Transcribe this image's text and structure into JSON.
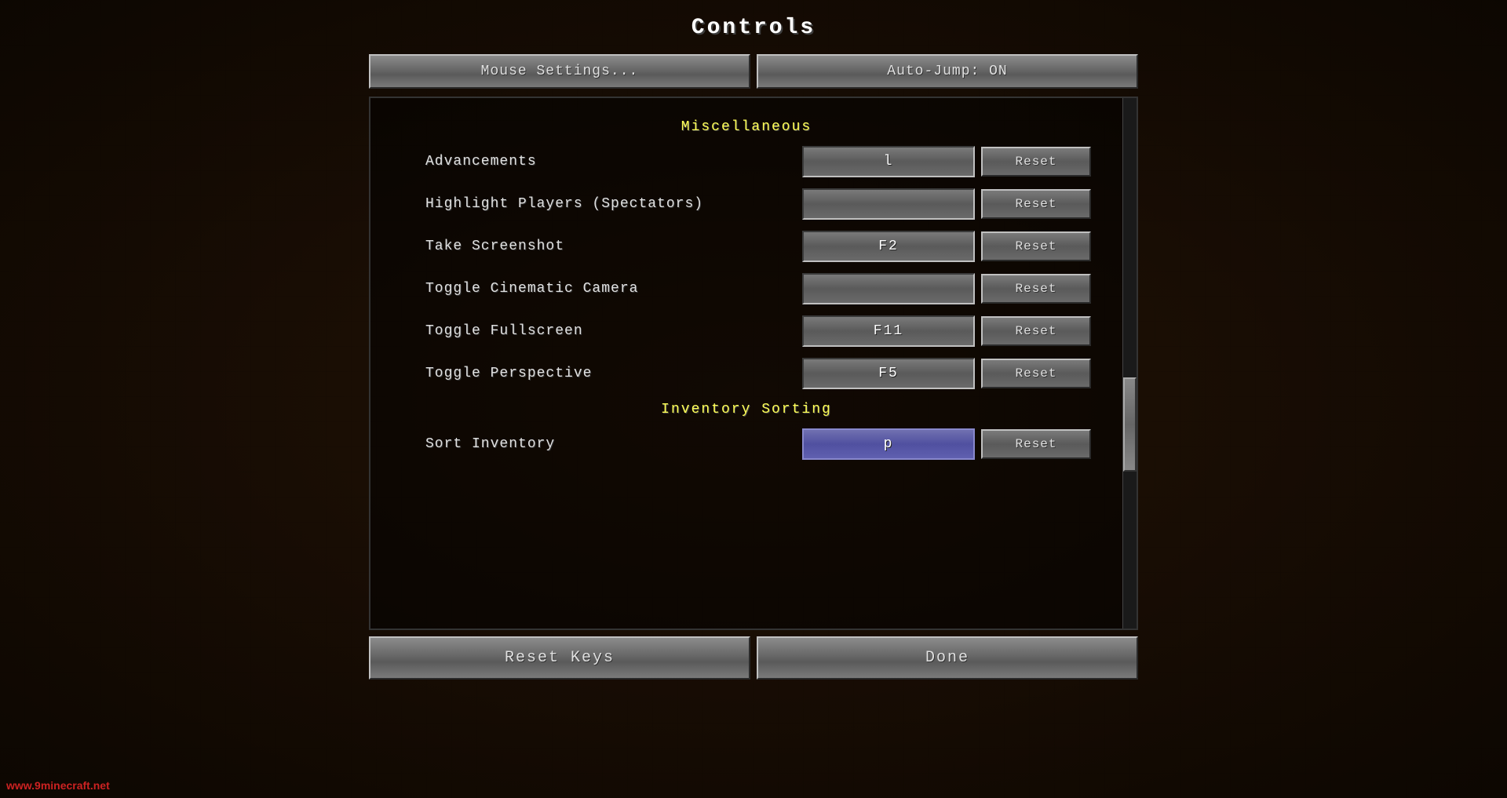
{
  "page": {
    "title": "Controls"
  },
  "top_buttons": {
    "mouse_settings": "Mouse Settings...",
    "auto_jump": "Auto-Jump: ON"
  },
  "sections": [
    {
      "id": "miscellaneous",
      "header": "Miscellaneous",
      "bindings": [
        {
          "label": "Advancements",
          "key": "l",
          "empty": false,
          "highlighted": false
        },
        {
          "label": "Highlight Players (Spectators)",
          "key": "",
          "empty": true,
          "highlighted": false
        },
        {
          "label": "Take Screenshot",
          "key": "F2",
          "empty": false,
          "highlighted": false
        },
        {
          "label": "Toggle Cinematic Camera",
          "key": "",
          "empty": true,
          "highlighted": false
        },
        {
          "label": "Toggle Fullscreen",
          "key": "F11",
          "empty": false,
          "highlighted": false
        },
        {
          "label": "Toggle Perspective",
          "key": "F5",
          "empty": false,
          "highlighted": false
        }
      ]
    },
    {
      "id": "inventory_sorting",
      "header": "Inventory Sorting",
      "bindings": [
        {
          "label": "Sort Inventory",
          "key": "p",
          "empty": false,
          "highlighted": true
        }
      ]
    }
  ],
  "bottom_buttons": {
    "reset_keys": "Reset Keys",
    "done": "Done"
  },
  "watermark": "www.9minecraft.net",
  "reset_label": "Reset"
}
